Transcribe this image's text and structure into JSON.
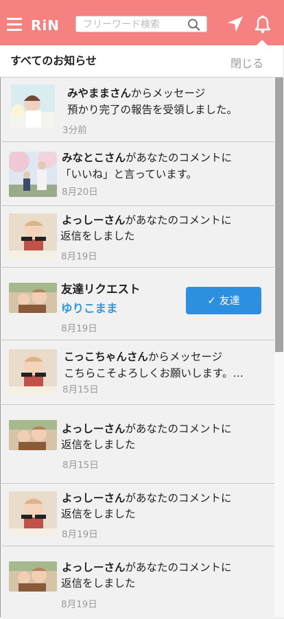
{
  "header": {
    "logo": "RiN",
    "search_placeholder": "フリーワード検索"
  },
  "panel": {
    "title": "すべてのお知らせ",
    "close_label": "閉じる"
  },
  "notifications": [
    {
      "name": "みやままさん",
      "rest": "からメッセージ",
      "line2": "預かり完了の報告を受領しました。",
      "date": "3分前"
    },
    {
      "name": "みなとこさん",
      "rest": "があなたのコメントに",
      "line2": "「いいね」と言っています。",
      "date": "8月20日"
    },
    {
      "name": "よっしーさん",
      "rest": "があなたのコメントに",
      "line2": "返信をしました",
      "date": "8月19日"
    },
    {
      "request_title": "友達リクエスト",
      "requester": "ゆりこまま",
      "button": "✓ 友達",
      "date": "8月19日"
    },
    {
      "name": "こっこちゃんさん",
      "rest": "からメッセージ",
      "line2": "こちらこそよろしくお願いします。…",
      "date": "8月15日"
    },
    {
      "name": "よっしーさん",
      "rest": "があなたのコメントに",
      "line2": "返信をしました",
      "date": "8月15日"
    },
    {
      "name": "よっしーさん",
      "rest": "があなたのコメントに",
      "line2": "返信をしました",
      "date": "8月19日"
    },
    {
      "name": "よっしーさん",
      "rest": "があなたのコメントに",
      "line2": "返信をしました",
      "date": "8月19日"
    }
  ],
  "colors": {
    "header_bg": "#f68181",
    "accent_blue": "#2d8fe0",
    "requester_blue": "#3498db"
  }
}
